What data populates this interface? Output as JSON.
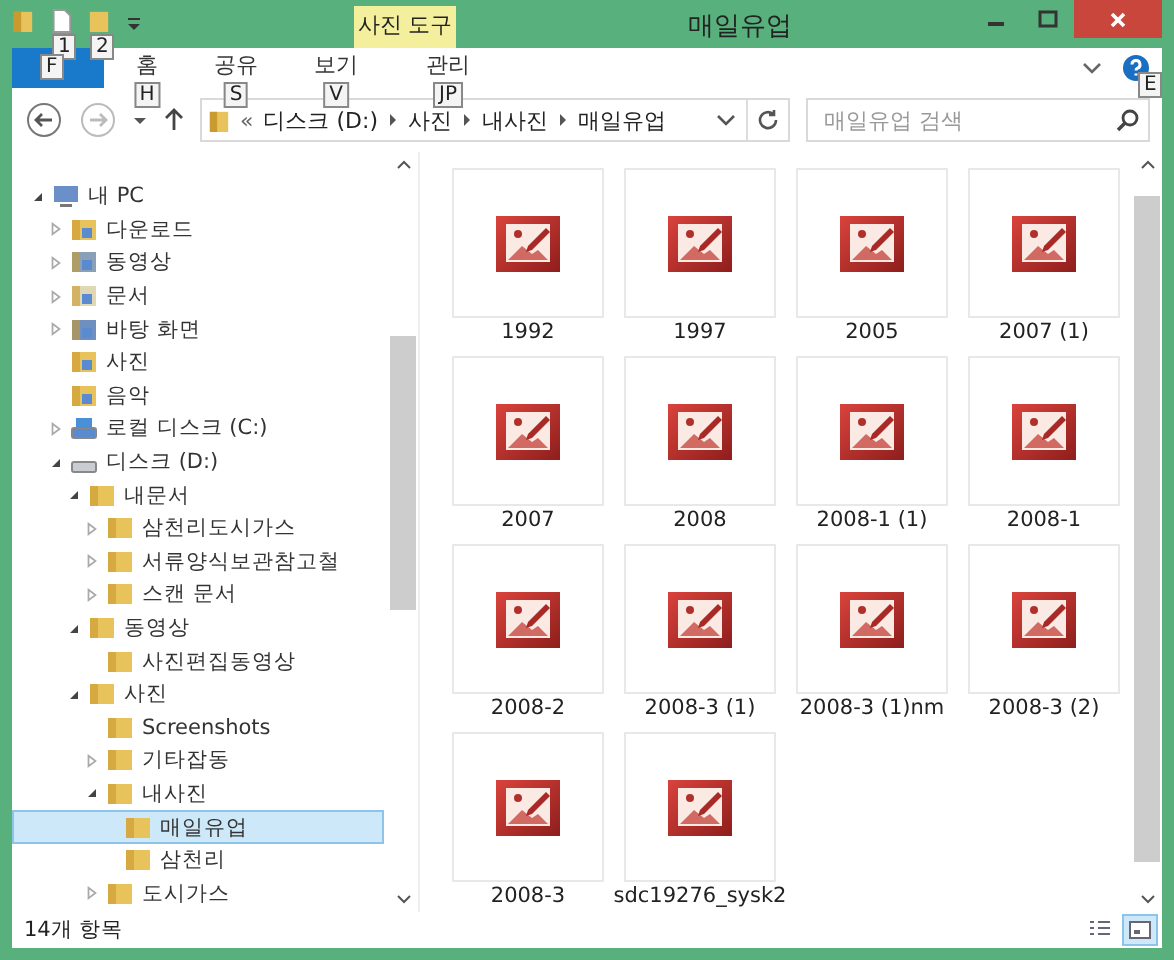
{
  "window": {
    "title": "매일유업"
  },
  "quick_access": [
    {
      "kind": "document",
      "keytip": "1"
    },
    {
      "kind": "folder",
      "keytip": "2"
    }
  ],
  "context_tab_group": "사진 도구",
  "file_tab": {
    "keytip": "F"
  },
  "ribbon_tabs": [
    {
      "label": "홈",
      "keytip": "H",
      "selected": false
    },
    {
      "label": "공유",
      "keytip": "S",
      "selected": false
    },
    {
      "label": "보기",
      "keytip": "V",
      "selected": false
    },
    {
      "label": "관리",
      "keytip": "JP",
      "selected": false
    }
  ],
  "help_keytip": "E",
  "address": {
    "overflow": "«",
    "crumbs": [
      "디스크 (D:)",
      "사진",
      "내사진",
      "매일유업"
    ]
  },
  "search": {
    "placeholder": "매일유업 검색"
  },
  "tree": [
    {
      "label": "내 PC",
      "kind": "pc",
      "expanded": true,
      "selected": false,
      "children": [
        {
          "label": "다운로드",
          "kind": "download",
          "expanded": false,
          "selected": false
        },
        {
          "label": "동영상",
          "kind": "video",
          "expanded": false,
          "selected": false
        },
        {
          "label": "문서",
          "kind": "document",
          "expanded": false,
          "selected": false
        },
        {
          "label": "바탕 화면",
          "kind": "desktop",
          "expanded": false,
          "selected": false
        },
        {
          "label": "사진",
          "kind": "picture",
          "selected": false
        },
        {
          "label": "음악",
          "kind": "music",
          "selected": false
        },
        {
          "label": "로컬 디스크 (C:)",
          "kind": "system-drive",
          "expanded": false,
          "selected": false
        },
        {
          "label": "디스크 (D:)",
          "kind": "drive",
          "expanded": true,
          "selected": false,
          "children": [
            {
              "label": "내문서",
              "kind": "folder",
              "expanded": true,
              "selected": false,
              "children": [
                {
                  "label": "삼천리도시가스",
                  "kind": "folder",
                  "expanded": false,
                  "selected": false
                },
                {
                  "label": "서류양식보관참고철",
                  "kind": "folder",
                  "expanded": false,
                  "selected": false
                },
                {
                  "label": "스캔 문서",
                  "kind": "folder",
                  "expanded": false,
                  "selected": false
                }
              ]
            },
            {
              "label": "동영상",
              "kind": "folder",
              "expanded": true,
              "selected": false,
              "children": [
                {
                  "label": "사진편집동영상",
                  "kind": "folder",
                  "selected": false
                }
              ]
            },
            {
              "label": "사진",
              "kind": "folder",
              "expanded": true,
              "selected": false,
              "children": [
                {
                  "label": "Screenshots",
                  "kind": "folder",
                  "selected": false
                },
                {
                  "label": "기타잡동",
                  "kind": "folder",
                  "expanded": false,
                  "selected": false
                },
                {
                  "label": "내사진",
                  "kind": "folder",
                  "expanded": true,
                  "selected": false,
                  "children": [
                    {
                      "label": "매일유업",
                      "kind": "folder",
                      "selected": true
                    },
                    {
                      "label": "삼천리",
                      "kind": "folder",
                      "selected": false
                    }
                  ]
                },
                {
                  "label": "도시가스",
                  "kind": "folder",
                  "expanded": false,
                  "selected": false
                }
              ]
            }
          ]
        }
      ]
    }
  ],
  "files": [
    {
      "name": "1992",
      "selected": false
    },
    {
      "name": "1997",
      "selected": false
    },
    {
      "name": "2005",
      "selected": false
    },
    {
      "name": "2007 (1)",
      "selected": false
    },
    {
      "name": "2007",
      "selected": false
    },
    {
      "name": "2008",
      "selected": false
    },
    {
      "name": "2008-1 (1)",
      "selected": false
    },
    {
      "name": "2008-1",
      "selected": false
    },
    {
      "name": "2008-2",
      "selected": false
    },
    {
      "name": "2008-3 (1)",
      "selected": false
    },
    {
      "name": "2008-3 (1)nm",
      "selected": false
    },
    {
      "name": "2008-3 (2)",
      "selected": false
    },
    {
      "name": "2008-3",
      "selected": false
    },
    {
      "name": "sdc19276_sysk2",
      "selected": false
    }
  ],
  "status_bar": {
    "text": "14개 항목"
  },
  "view_buttons": [
    {
      "kind": "details",
      "selected": false
    },
    {
      "kind": "thumbnails",
      "selected": true
    }
  ]
}
